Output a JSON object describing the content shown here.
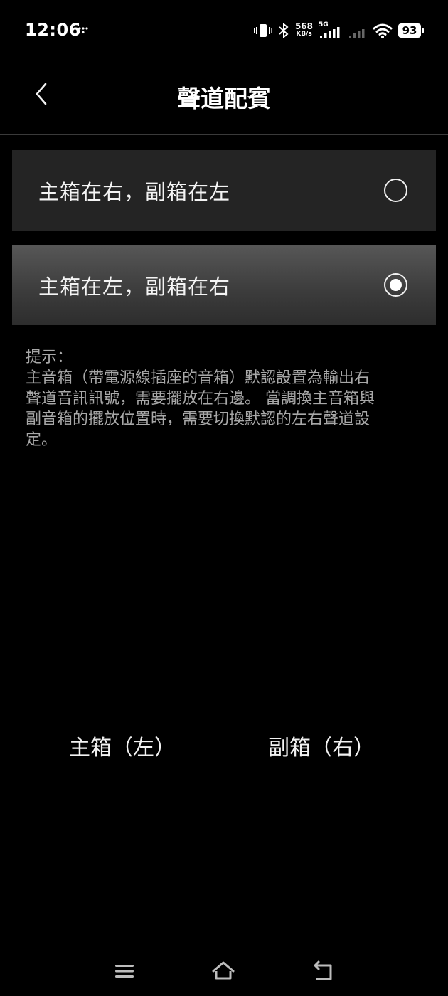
{
  "status_bar": {
    "time": "12:06",
    "net_speed_value": "568",
    "net_speed_unit": "KB/s",
    "network_type": "5G",
    "battery_level": "93",
    "icons": [
      "tiktok-notification-icon",
      "vibrate-icon",
      "bluetooth-icon",
      "signal-5g-icon",
      "signal-icon",
      "wifi-icon",
      "battery-icon"
    ]
  },
  "header": {
    "title": "聲道配賓"
  },
  "options": [
    {
      "label": "主箱在右，副箱在左",
      "selected": false
    },
    {
      "label": "主箱在左，副箱在右",
      "selected": true
    }
  ],
  "hint": {
    "lines": [
      "提示：",
      "主音箱（帶電源線插座的音箱）默認設置為輸出右",
      "聲道音訊訊號，需要擺放在右邊。 當調換主音箱與",
      "副音箱的擺放位置時，需要切換默認的左右聲道設",
      "定。"
    ]
  },
  "speakers": {
    "main_label": "主箱（左）",
    "sub_label": "副箱（右）"
  },
  "colors": {
    "background": "#000000",
    "option_bg": "#242424",
    "option_selected_top": "#575757",
    "hint_text": "#a8a8a8"
  }
}
